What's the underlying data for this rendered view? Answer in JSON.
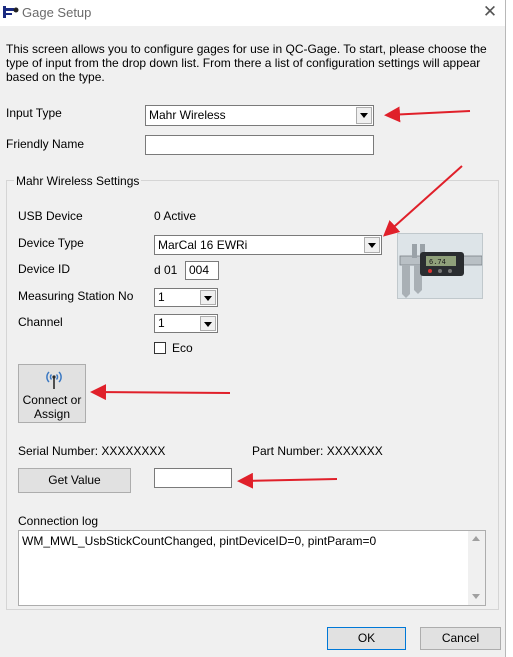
{
  "window": {
    "title": "Gage Setup",
    "close_glyph": "✕"
  },
  "intro": "This screen allows you to configure gages for use in QC-Gage. To start, please choose the type of input from the drop down list. From there a list of configuration settings will appear based on the type.",
  "input_type": {
    "label": "Input Type",
    "value": "Mahr Wireless"
  },
  "friendly_name": {
    "label": "Friendly Name",
    "value": ""
  },
  "group": {
    "title": "Mahr Wireless Settings",
    "usb_device": {
      "label": "USB Device",
      "value": "0 Active"
    },
    "device_type": {
      "label": "Device Type",
      "value": "MarCal 16 EWRi"
    },
    "device_id": {
      "label": "Device ID",
      "prefix": "d 01",
      "value": "004"
    },
    "measuring_station": {
      "label": "Measuring Station No",
      "value": "1"
    },
    "channel": {
      "label": "Channel",
      "value": "1"
    },
    "eco": {
      "label": "Eco",
      "checked": false
    },
    "connect_button": {
      "line1": "Connect or",
      "line2": "Assign"
    },
    "serial_number": "Serial Number: XXXXXXXX",
    "part_number": "Part Number: XXXXXXX",
    "get_value_button": "Get Value",
    "value_field": "",
    "connection_log": {
      "label": "Connection log",
      "text": "WM_MWL_UsbStickCountChanged, pintDeviceID=0, pintParam=0"
    }
  },
  "footer": {
    "ok": "OK",
    "cancel": "Cancel"
  },
  "colors": {
    "annotation_arrow": "#e0202a",
    "window_bg": "#f0f0f0"
  },
  "icons": [
    "gage-app-icon",
    "close-icon",
    "wireless-antenna-icon",
    "caliper-image",
    "dropdown-arrow-icon"
  ]
}
